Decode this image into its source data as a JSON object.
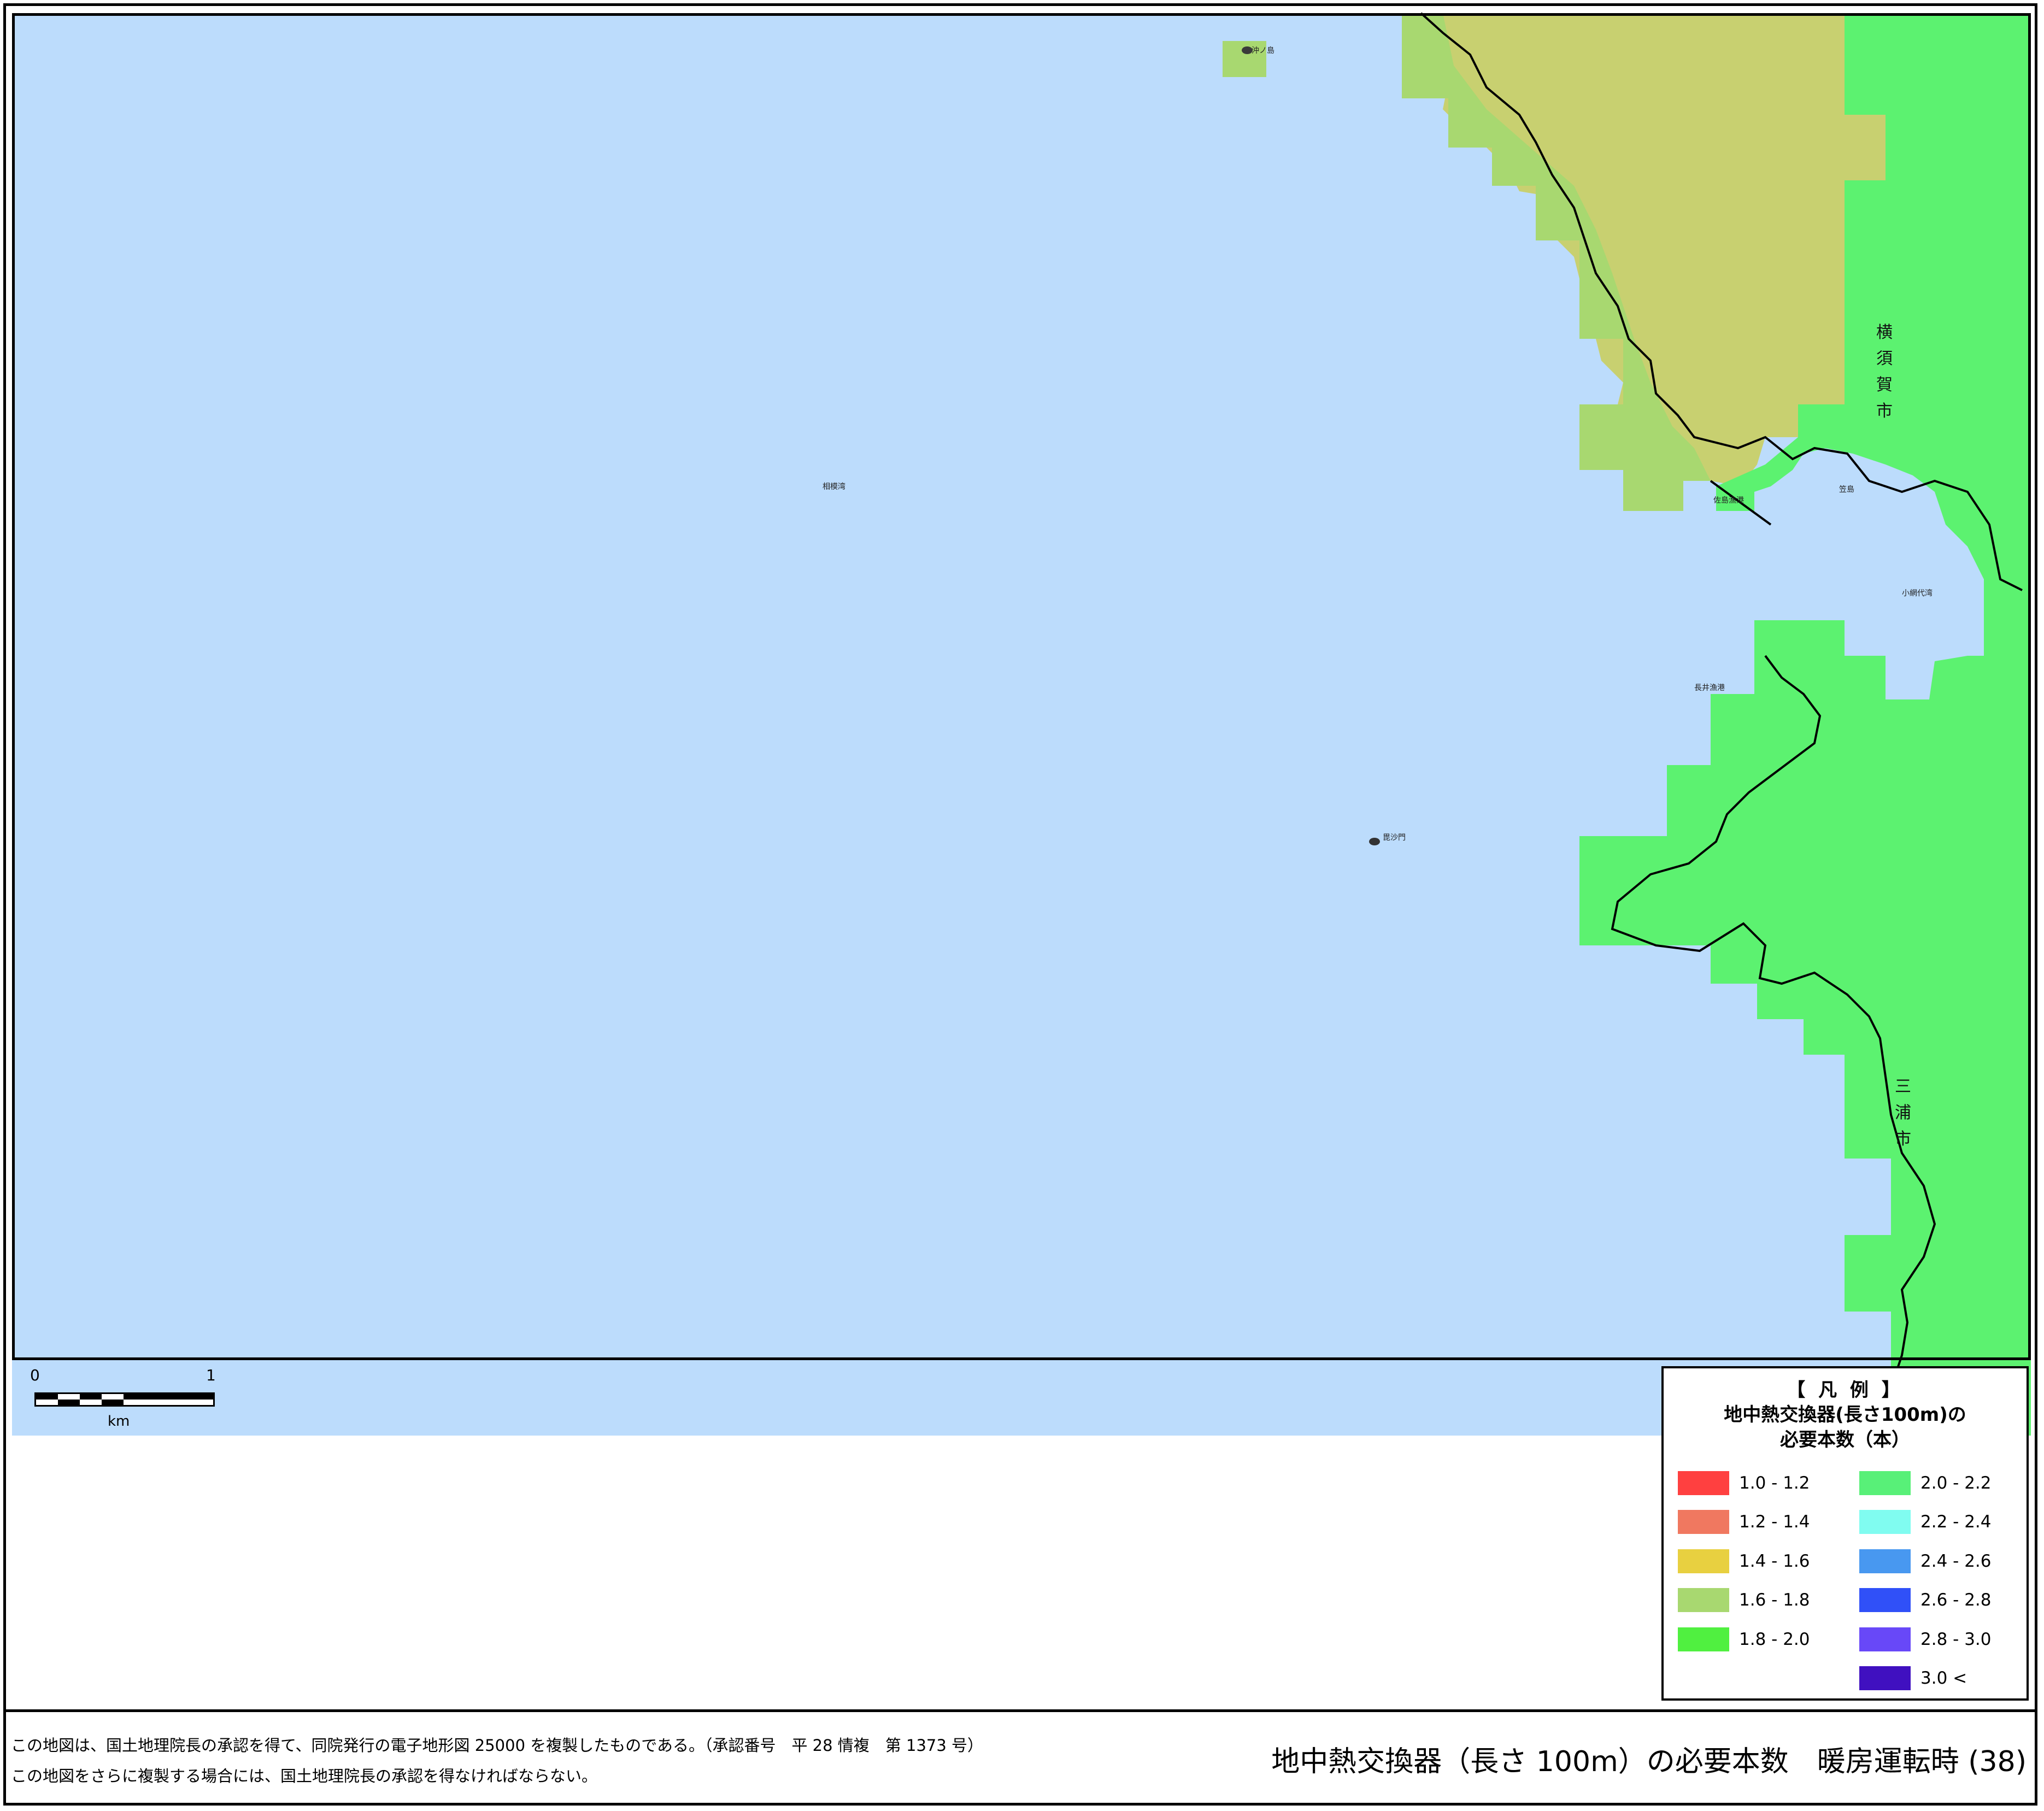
{
  "map": {
    "place_labels": [
      "沖ノ島",
      "相模湾",
      "佐島漁港",
      "笠島",
      "長井漁港",
      "小網代湾",
      "毘沙門"
    ],
    "city_labels": [
      {
        "text": "横須賀市"
      },
      {
        "text": "三浦市"
      }
    ]
  },
  "scale_bar": {
    "start": "0",
    "end": "1",
    "unit": "km"
  },
  "legend": {
    "title": "【 凡 例 】",
    "subtitle": "地中熱交換器(長さ100m)の\n必要本数（本）",
    "items": [
      {
        "label": "1.0 - 1.2",
        "color": "#ff4040"
      },
      {
        "label": "1.2 - 1.4",
        "color": "#f07860"
      },
      {
        "label": "1.4 - 1.6",
        "color": "#e8d040"
      },
      {
        "label": "1.6 - 1.8",
        "color": "#a8d870"
      },
      {
        "label": "1.8 - 2.0",
        "color": "#50f040"
      },
      {
        "label": "2.0 - 2.2",
        "color": "#58f078"
      },
      {
        "label": "2.2 - 2.4",
        "color": "#80fcf0"
      },
      {
        "label": "2.4 - 2.6",
        "color": "#4898f0"
      },
      {
        "label": "2.6 - 2.8",
        "color": "#3050f8"
      },
      {
        "label": "2.8 - 3.0",
        "color": "#6848f8"
      },
      {
        "label": "3.0 <",
        "color": "#4010c0"
      }
    ]
  },
  "footer": {
    "note_line1": "この地図は、国土地理院長の承認を得て、同院発行の電子地形図 25000 を複製したものである。（承認番号　平 28 情複　第 1373 号）",
    "note_line2": "この地図をさらに複製する場合には、国土地理院長の承認を得なければならない。",
    "title": "地中熱交換器（長さ 100m）の必要本数　暖房運転時 (38)"
  },
  "colors": {
    "sea": "#bcdcfc",
    "land_green": "#5cf270",
    "land_yellow": "#c8d070",
    "land_light_green": "#a8d870"
  }
}
